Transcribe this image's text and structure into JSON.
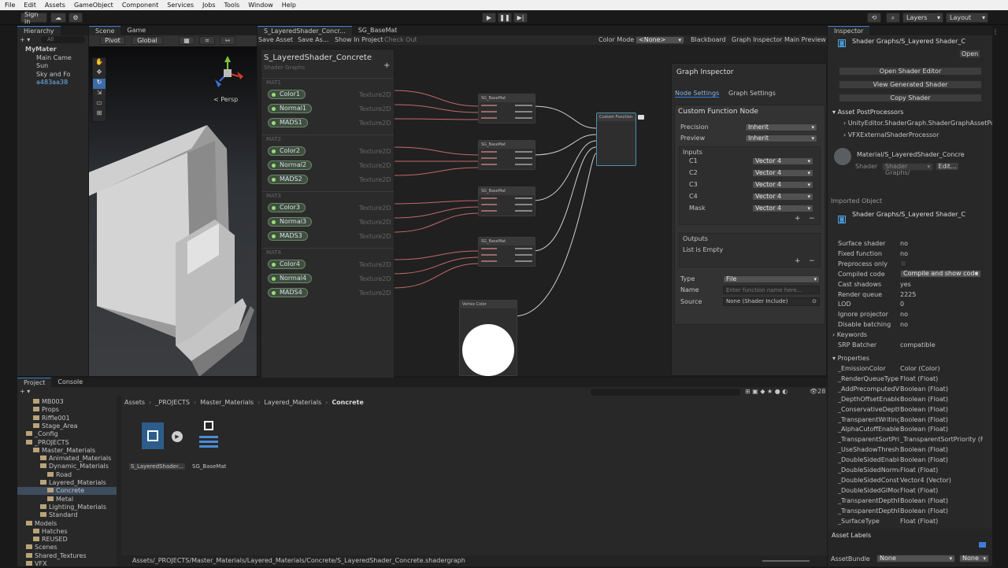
{
  "menu": [
    "File",
    "Edit",
    "Assets",
    "GameObject",
    "Component",
    "Services",
    "Jobs",
    "Tools",
    "Window",
    "Help"
  ],
  "toolbar": {
    "sign_in": "Sign in",
    "layers": "Layers",
    "layout": "Layout"
  },
  "hierarchy": {
    "tab": "Hierarchy",
    "search": "All",
    "items": [
      "MyMater",
      "Main Came",
      "Sun",
      "Sky and Fo",
      "a483aa38"
    ]
  },
  "scene": {
    "tab_scene": "Scene",
    "tab_game": "Game",
    "pivot": "Pivot",
    "global": "Global",
    "persp": "Persp"
  },
  "shader": {
    "tab1": "S_LayeredShader_Concr...",
    "tab2": "SG_BaseMat",
    "save_asset": "Save Asset",
    "save_as": "Save As...",
    "show_in_project": "Show In Project",
    "check_out": "Check Out",
    "color_mode_label": "Color Mode",
    "color_mode_value": "<None>",
    "blackboard": "Blackboard",
    "graph_inspector": "Graph Inspector",
    "main_preview": "Main Preview",
    "blackboard_title": "S_LayeredShader_Concrete",
    "blackboard_sub": "Shader Graphs",
    "groups": [
      {
        "name": "MAT1",
        "props": [
          {
            "n": "Color1",
            "t": "Texture2D"
          },
          {
            "n": "Normal1",
            "t": "Texture2D"
          },
          {
            "n": "MADS1",
            "t": "Texture2D"
          }
        ]
      },
      {
        "name": "MAT2",
        "props": [
          {
            "n": "Color2",
            "t": "Texture2D"
          },
          {
            "n": "Normal2",
            "t": "Texture2D"
          },
          {
            "n": "MADS2",
            "t": "Texture2D"
          }
        ]
      },
      {
        "name": "MAT3",
        "props": [
          {
            "n": "Color3",
            "t": "Texture2D"
          },
          {
            "n": "Normal3",
            "t": "Texture2D"
          },
          {
            "n": "MADS3",
            "t": "Texture2D"
          }
        ]
      },
      {
        "name": "MAT4",
        "props": [
          {
            "n": "Color4",
            "t": "Texture2D"
          },
          {
            "n": "Normal4",
            "t": "Texture2D"
          },
          {
            "n": "MADS4",
            "t": "Texture2D"
          }
        ]
      }
    ],
    "node_label": "SG_BaseMat",
    "vertex_color": "Vertex Color",
    "custom_fn": "Custom Function"
  },
  "graph_inspector": {
    "title": "Graph Inspector",
    "tab_node": "Node Settings",
    "tab_graph": "Graph Settings",
    "node_title": "Custom Function Node",
    "precision_label": "Precision",
    "precision_value": "Inherit",
    "preview_label": "Preview",
    "preview_value": "Inherit",
    "inputs_label": "Inputs",
    "inputs": [
      {
        "n": "C1",
        "t": "Vector 4"
      },
      {
        "n": "C2",
        "t": "Vector 4"
      },
      {
        "n": "C3",
        "t": "Vector 4"
      },
      {
        "n": "C4",
        "t": "Vector 4"
      },
      {
        "n": "Mask",
        "t": "Vector 4"
      }
    ],
    "outputs_label": "Outputs",
    "outputs_empty": "List is Empty",
    "type_label": "Type",
    "type_value": "File",
    "name_label": "Name",
    "name_placeholder": "Enter function name here...",
    "source_label": "Source",
    "source_value": "None (Shader Include)"
  },
  "inspector": {
    "tab": "Inspector",
    "title": "Shader Graphs/S_Layered Shader_C",
    "open": "Open",
    "open_editor": "Open Shader Editor",
    "view_generated": "View Generated Shader",
    "copy_shader": "Copy Shader",
    "postprocessors_title": "Asset PostProcessors",
    "postprocessors": [
      "UnityEditor.ShaderGraph.ShaderGraphAssetPos",
      "VFXExternalShaderProcessor"
    ],
    "material": "Material/S_LayeredShader_Concre",
    "shader_label": "Shader",
    "shader_value": "Shader Graphs/",
    "edit": "Edit...",
    "imported_object": "Imported Object",
    "imported_title": "Shader Graphs/S_Layered Shader_C",
    "props": [
      {
        "k": "Surface shader",
        "v": "no"
      },
      {
        "k": "Fixed function",
        "v": "no"
      },
      {
        "k": "Preprocess only",
        "v": ""
      },
      {
        "k": "Compiled code",
        "v": "Compile and show code"
      },
      {
        "k": "Cast shadows",
        "v": "yes"
      },
      {
        "k": "Render queue",
        "v": "2225"
      },
      {
        "k": "LOD",
        "v": "0"
      },
      {
        "k": "Ignore projector",
        "v": "no"
      },
      {
        "k": "Disable batching",
        "v": "no"
      }
    ],
    "keywords": "Keywords",
    "srp_batcher_k": "SRP Batcher",
    "srp_batcher_v": "compatible",
    "properties": "Properties",
    "shader_props": [
      {
        "k": "_EmissionColor",
        "v": "Color (Color)"
      },
      {
        "k": "_RenderQueueType",
        "v": "Float (Float)"
      },
      {
        "k": "_AddPrecomputedVel",
        "v": "Boolean (Float)"
      },
      {
        "k": "_DepthOffsetEnable",
        "v": "Boolean (Float)"
      },
      {
        "k": "_ConservativeDepthC",
        "v": "Boolean (Float)"
      },
      {
        "k": "_TransparentWritingM",
        "v": "Boolean (Float)"
      },
      {
        "k": "_AlphaCutoffEnable",
        "v": "Boolean (Float)"
      },
      {
        "k": "_TransparentSortPrio",
        "v": "_TransparentSortPriority (Flo"
      },
      {
        "k": "_UseShadowThresho",
        "v": "Boolean (Float)"
      },
      {
        "k": "_DoubleSidedEnable",
        "v": "Boolean (Float)"
      },
      {
        "k": "_DoubleSidedNormal",
        "v": "Float (Float)"
      },
      {
        "k": "_DoubleSidedConsta",
        "v": "Vector4 (Vector)"
      },
      {
        "k": "_DoubleSidedGIMode",
        "v": "Float (Float)"
      },
      {
        "k": "_TransparentDepthPr",
        "v": "Boolean (Float)"
      },
      {
        "k": "_TransparentDepthP",
        "v": "Boolean (Float)"
      },
      {
        "k": "_SurfaceType",
        "v": "Float (Float)"
      }
    ],
    "asset_labels": "Asset Labels",
    "asset_bundle": "AssetBundle",
    "bundle_value": "None",
    "bundle_variant": "None"
  },
  "project": {
    "tab_project": "Project",
    "tab_console": "Console",
    "count": "28",
    "tree": [
      {
        "n": "MB003",
        "d": 2
      },
      {
        "n": "Props",
        "d": 2
      },
      {
        "n": "Riffle001",
        "d": 2
      },
      {
        "n": "Stage_Area",
        "d": 2
      },
      {
        "n": "_Config",
        "d": 1
      },
      {
        "n": "_PROJECTS",
        "d": 1
      },
      {
        "n": "Master_Materials",
        "d": 2
      },
      {
        "n": "Animated_Materials",
        "d": 3
      },
      {
        "n": "Dynamic_Materials",
        "d": 3
      },
      {
        "n": "Road",
        "d": 4
      },
      {
        "n": "Layered_Materials",
        "d": 3
      },
      {
        "n": "Concrete",
        "d": 4
      },
      {
        "n": "Metal",
        "d": 4
      },
      {
        "n": "Lighting_Materials",
        "d": 3
      },
      {
        "n": "Standard",
        "d": 3
      },
      {
        "n": "Models",
        "d": 1
      },
      {
        "n": "Hatches",
        "d": 2
      },
      {
        "n": "REUSED",
        "d": 2
      },
      {
        "n": "Scenes",
        "d": 1
      },
      {
        "n": "Shared_Textures",
        "d": 1
      },
      {
        "n": "VFX",
        "d": 1
      }
    ],
    "breadcrumb": [
      "Assets",
      "_PROJECTS",
      "Master_Materials",
      "Layered_Materials",
      "Concrete"
    ],
    "assets": [
      "S_LayeredShader...",
      "SG_BaseMat"
    ],
    "path": "Assets/_PROJECTS/Master_Materials/Layered_Materials/Concrete/S_LayeredShader_Concrete.shadergraph"
  }
}
